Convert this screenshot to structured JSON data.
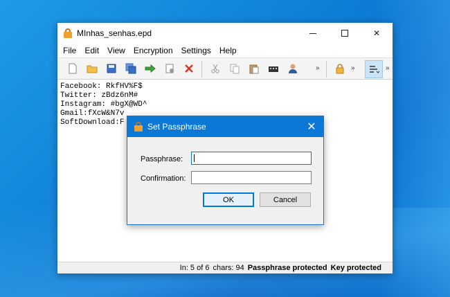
{
  "window": {
    "title": "MInhas_senhas.epd",
    "close_glyph": "✕"
  },
  "menu": [
    "File",
    "Edit",
    "View",
    "Encryption",
    "Settings",
    "Help"
  ],
  "toolbar": {
    "icons": [
      "new-file-icon",
      "open-folder-icon",
      "save-icon",
      "save-as-icon",
      "export-icon",
      "properties-icon",
      "delete-icon",
      "cut-icon",
      "copy-icon",
      "paste-icon",
      "keyboard-icon",
      "user-icon",
      "lock-icon",
      "list-icon"
    ],
    "overflow_glyph": "»"
  },
  "editor": {
    "lines": [
      "Facebook: RkfHV%F$",
      "Twitter: zBdz6nM#",
      "Instagram: #bgX@WD^",
      "Gmail:fXcW&N7v",
      "SoftDownload:F"
    ]
  },
  "status": {
    "position": "In: 5 of 6",
    "chars": "chars: 94",
    "passphrase": "Passphrase protected",
    "key": "Key protected"
  },
  "dialog": {
    "title": "Set Passphrase",
    "close_glyph": "✕",
    "passphrase_label": "Passphrase:",
    "passphrase_value": "",
    "confirmation_label": "Confirmation:",
    "confirmation_value": "",
    "ok_label": "OK",
    "cancel_label": "Cancel"
  },
  "colors": {
    "accent": "#0a78d4",
    "desktop": "#0f7fd6"
  }
}
